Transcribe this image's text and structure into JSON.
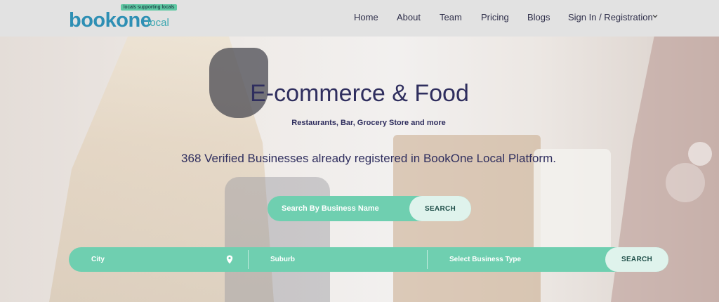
{
  "logo": {
    "tagline": "locals supporting locals",
    "main": "bookone",
    "sub": "local"
  },
  "nav": {
    "items": [
      {
        "label": "Home"
      },
      {
        "label": "About"
      },
      {
        "label": "Team"
      },
      {
        "label": "Pricing"
      },
      {
        "label": "Blogs"
      },
      {
        "label": "Sign In / Registration"
      }
    ],
    "dropdown_icon": "chevron-down-icon"
  },
  "hero": {
    "title": "E-commerce & Food",
    "subtitle": "Restaurants, Bar, Grocery Store and more",
    "count_text": "368 Verified Businesses already registered in BookOne Local Platform."
  },
  "name_search": {
    "placeholder": "Search By Business Name",
    "value": "",
    "button_label": "SEARCH"
  },
  "filters": {
    "city_placeholder": "City",
    "city_icon": "map-pin-icon",
    "suburb_placeholder": "Suburb",
    "business_type_placeholder": "Select Business Type",
    "button_label": "SEARCH"
  },
  "colors": {
    "accent": "#6fcfb0",
    "button_bg": "#dff3ec",
    "text_dark": "#2f2e5e",
    "header_bg": "#e2e2e2",
    "logo_blue": "#2e8fb4"
  }
}
